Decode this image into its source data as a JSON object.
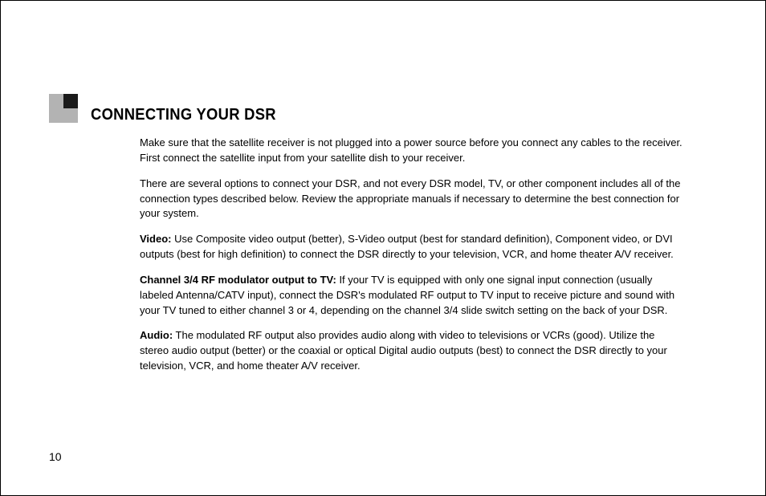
{
  "heading": "CONNECTING YOUR DSR",
  "paragraphs": {
    "intro": "Make sure that the satellite receiver is not plugged into a power source before you connect any cables to the receiver. First connect the satellite input from your satellite dish to your receiver.",
    "options": "There are several options to connect your DSR, and not every DSR model, TV, or other component includes all of the connection types described below. Review the appropriate manuals if necessary to determine the best connection for your system.",
    "video_label": "Video:",
    "video_text": " Use Composite video output (better), S-Video output (best for standard definition), Component video, or DVI outputs (best for high definition) to connect the DSR directly to your television, VCR, and home theater A/V receiver.",
    "rf_label": "Channel 3/4 RF modulator output to TV:",
    "rf_text": " If your TV is equipped with only one signal input connection (usually labeled Antenna/CATV input), connect the DSR's modulated RF output to TV input to receive picture and sound with your TV tuned to either channel 3 or 4, depending on the channel 3/4 slide switch setting on the back of your DSR.",
    "audio_label": "Audio:",
    "audio_text": " The modulated RF output also provides audio along with video to televisions or VCRs (good). Utilize the stereo audio output (better) or the coaxial or optical Digital audio outputs (best) to connect the DSR directly to your television, VCR, and home theater A/V receiver."
  },
  "page_number": "10"
}
